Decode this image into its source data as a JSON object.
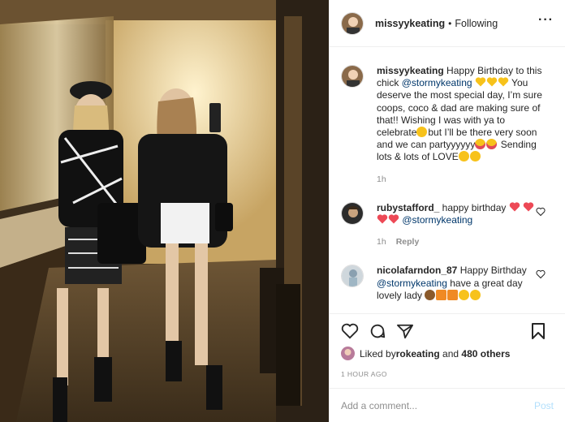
{
  "post_author": {
    "username": "missyykeating",
    "follow_status": "Following",
    "separator": "•"
  },
  "caption": {
    "username": "missyykeating",
    "text_1": " Happy Birthday to this chick ",
    "mention": "@stormykeating",
    "text_2": " You deserve the most special day, I’m sure coops, coco & dad are making sure of that!! Wishing I was with ya to celebrate",
    "text_3": "but I’ll be there very soon and we can partyyyyyy",
    "text_4": " Sending lots & lots of LOVE",
    "time": "1h"
  },
  "comments": [
    {
      "username": "rubystafford_",
      "text": " happy birthday ",
      "mention": "@stormykeating",
      "time": "1h",
      "reply_label": "Reply"
    },
    {
      "username": "nicolafarndon_87",
      "text": " Happy Birthday ",
      "mention": "@stormykeating",
      "text_2": " have a great day lovely lady "
    }
  ],
  "likes": {
    "prefix": "Liked by ",
    "user": "rokeating",
    "and": " and ",
    "count": "480 others"
  },
  "timestamp": "1 HOUR AGO",
  "add_comment": {
    "placeholder": "Add a comment...",
    "post_label": "Post"
  },
  "colors": {
    "mention": "#00376b",
    "heart_red": "#ed4956",
    "emoji_yellow": "#f7c21b",
    "post_disabled": "#b2dffc"
  }
}
